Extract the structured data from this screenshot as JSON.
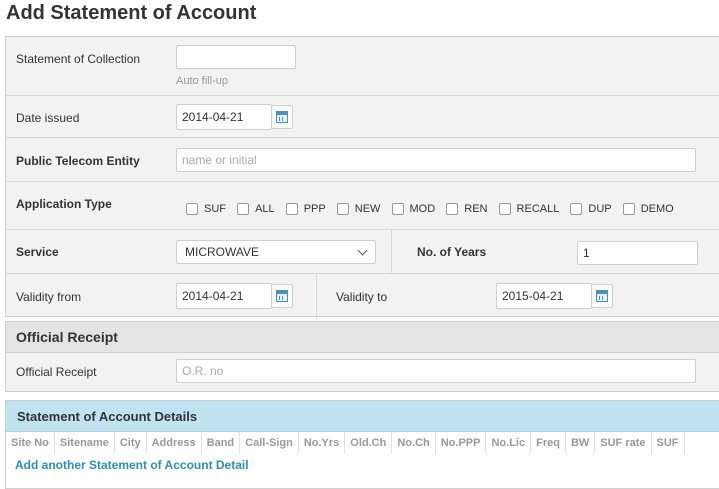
{
  "page_title": "Add Statement of Account",
  "form": {
    "soc": {
      "label": "Statement of Collection",
      "value": "",
      "hint": "Auto fill-up"
    },
    "date_issued": {
      "label": "Date issued",
      "value": "2014-04-21"
    },
    "entity": {
      "label": "Public Telecom Entity",
      "placeholder": "name or initial"
    },
    "app_type": {
      "label": "Application Type",
      "options": [
        "SUF",
        "ALL",
        "PPP",
        "NEW",
        "MOD",
        "REN",
        "RECALL",
        "DUP",
        "DEMO"
      ]
    },
    "service": {
      "label": "Service",
      "value": "MICROWAVE"
    },
    "years": {
      "label": "No. of Years",
      "value": "1"
    },
    "validity_from": {
      "label": "Validity from",
      "value": "2014-04-21"
    },
    "validity_to": {
      "label": "Validity to",
      "value": "2015-04-21"
    }
  },
  "receipt": {
    "title": "Official Receipt",
    "label": "Official Receipt",
    "placeholder": "O.R. no"
  },
  "details": {
    "title": "Statement of Account Details",
    "columns": [
      "Site No",
      "Sitename",
      "City",
      "Address",
      "Band",
      "Call-Sign",
      "No.Yrs",
      "Old.Ch",
      "No.Ch",
      "No.PPP",
      "No.Lic",
      "Freq",
      "BW",
      "SUF rate",
      "SUF"
    ],
    "add_link": "Add another Statement of Account Detail"
  }
}
